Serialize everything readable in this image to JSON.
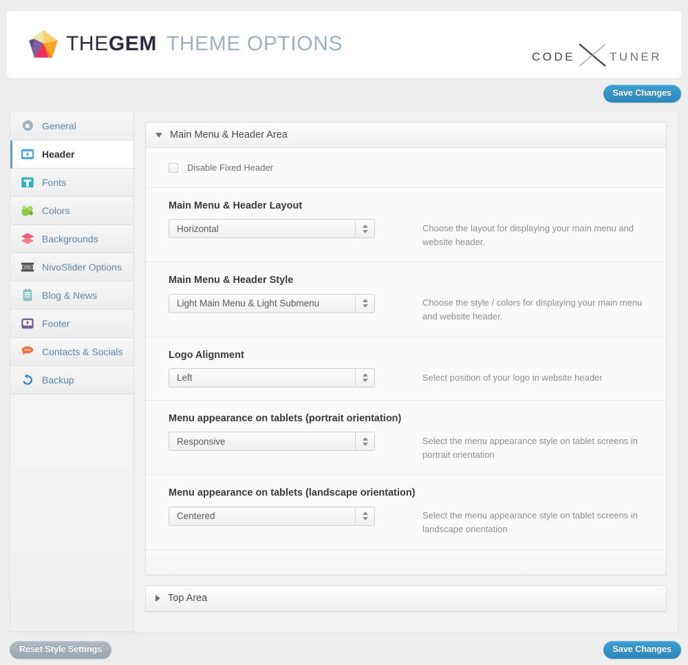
{
  "brand": {
    "logo_icon": "gem-pentagon-logo",
    "the": "THE",
    "gem": "GEM",
    "theme_options": "THEME OPTIONS",
    "partner_code": "CODE",
    "partner_tuner": "TUNER",
    "partner_x_icon": "x-cross-icon"
  },
  "colors": {
    "accent_blue": "#4fa3d9",
    "save_button": "#2b86ba",
    "reset_button": "#9aa5af",
    "sidebar_link": "#5e87a8",
    "page_bg": "#eeeeee"
  },
  "toolbar": {
    "save_top_label": "Save Changes",
    "save_bottom_label": "Save Changes",
    "reset_label": "Reset Style Settings"
  },
  "sidebar": {
    "items": [
      {
        "label": "General",
        "icon": "gear-icon",
        "active": false
      },
      {
        "label": "Header",
        "icon": "header-box-icon",
        "active": true
      },
      {
        "label": "Fonts",
        "icon": "typography-t-icon",
        "active": false
      },
      {
        "label": "Colors",
        "icon": "palette-icon",
        "active": false
      },
      {
        "label": "Backgrounds",
        "icon": "layers-icon",
        "active": false
      },
      {
        "label": "NivoSlider Options",
        "icon": "filmstrip-icon",
        "active": false
      },
      {
        "label": "Blog & News",
        "icon": "notebook-icon",
        "active": false
      },
      {
        "label": "Footer",
        "icon": "footer-box-icon",
        "active": false
      },
      {
        "label": "Contacts & Socials",
        "icon": "speech-bubble-icon",
        "active": false
      },
      {
        "label": "Backup",
        "icon": "restore-arrow-icon",
        "active": false
      }
    ]
  },
  "main_panel": {
    "title": "Main Menu & Header Area",
    "expanded": true,
    "toggle_icon": "chevron-down-icon",
    "checkbox": {
      "label": "Disable Fixed Header",
      "checked": false
    },
    "fields": [
      {
        "title": "Main Menu & Header Layout",
        "value": "Horizontal",
        "description": "Choose the layout for displaying your main menu and website header."
      },
      {
        "title": "Main Menu & Header Style",
        "value": "Light Main Menu & Light Submenu",
        "description": "Choose the style / colors for displaying your main menu and website header."
      },
      {
        "title": "Logo Alignment",
        "value": "Left",
        "description": "Select position of your logo in website header"
      },
      {
        "title": "Menu appearance on tablets (portrait orientation)",
        "value": "Responsive",
        "description": "Select the menu appearance style on tablet screens in portrait orientation"
      },
      {
        "title": "Menu appearance on tablets (landscape orientation)",
        "value": "Centered",
        "description": "Select the menu appearance style on tablet screens in landscape orientation"
      }
    ]
  },
  "top_area_panel": {
    "title": "Top Area",
    "expanded": false,
    "toggle_icon": "chevron-right-icon"
  }
}
